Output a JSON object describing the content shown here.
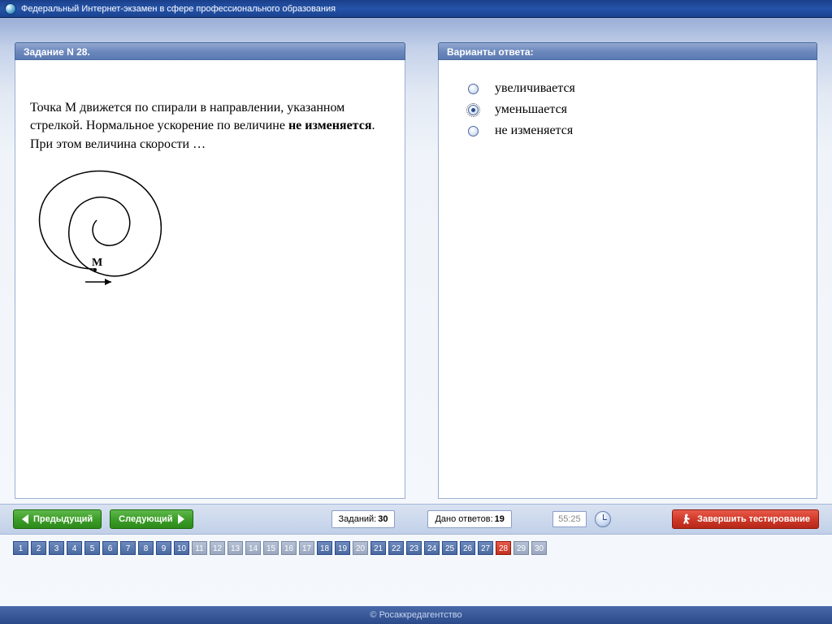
{
  "window": {
    "title": "Федеральный Интернет-экзамен в сфере профессионального образования"
  },
  "question_panel": {
    "header": "Задание N 28.",
    "text_parts": {
      "p1": "Точка М движется по спирали в направлении, указанном стрелкой. Нормальное ускорение по величине ",
      "bold": "не изменяется",
      "p2": ". При этом величина скорости …"
    },
    "diagram_label": "M"
  },
  "answers_panel": {
    "header": "Варианты ответа:",
    "options": [
      {
        "label": "увеличивается",
        "selected": false
      },
      {
        "label": "уменьшается",
        "selected": true
      },
      {
        "label": "не изменяется",
        "selected": false
      }
    ]
  },
  "controls": {
    "prev": "Предыдущий",
    "next": "Следующий",
    "tasks_label": "Заданий:",
    "tasks_value": "30",
    "answered_label": "Дано ответов:",
    "answered_value": "19",
    "timer": "55:25",
    "finish": "Завершить тестирование"
  },
  "qnav": {
    "total": 30,
    "current": 28,
    "unanswered": [
      11,
      12,
      13,
      14,
      15,
      16,
      17,
      20,
      29,
      30
    ]
  },
  "footer": "© Росаккредагентство"
}
